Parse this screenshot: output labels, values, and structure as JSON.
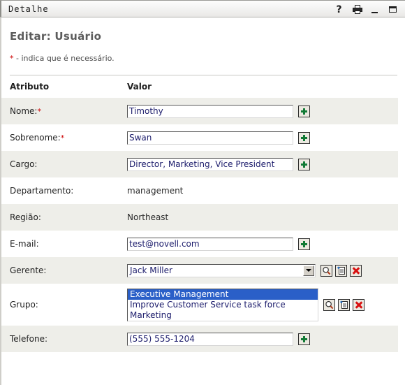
{
  "window": {
    "title": "Detalhe",
    "buttons": [
      {
        "name": "help-icon",
        "glyph": "?"
      },
      {
        "name": "print-icon",
        "glyph": "print"
      },
      {
        "name": "minimize-icon",
        "glyph": "_"
      },
      {
        "name": "maximize-icon",
        "glyph": "square"
      }
    ]
  },
  "page": {
    "title": "Editar: Usuário",
    "required_note_asterisk": "*",
    "required_note": " - indica que é necessário."
  },
  "table": {
    "headers": {
      "attribute": "Atributo",
      "value": "Valor"
    },
    "rows": [
      {
        "label": "Nome:",
        "required": "*",
        "value": "Timothy",
        "control": "text",
        "actions": [
          "plus"
        ]
      },
      {
        "label": "Sobrenome:",
        "required": "*",
        "value": "Swan",
        "control": "text",
        "actions": [
          "plus"
        ]
      },
      {
        "label": "Cargo:",
        "required": "",
        "value": "Director, Marketing, Vice President",
        "control": "text",
        "actions": [
          "plus"
        ]
      },
      {
        "label": "Departamento:",
        "required": "",
        "value": "management",
        "control": "static",
        "actions": []
      },
      {
        "label": "Região:",
        "required": "",
        "value": "Northeast",
        "control": "static",
        "actions": []
      },
      {
        "label": "E-mail:",
        "required": "",
        "value": "test@novell.com",
        "control": "text",
        "actions": [
          "plus"
        ]
      },
      {
        "label": "Gerente:",
        "required": "",
        "value": "Jack Miller",
        "control": "select",
        "actions": [
          "search",
          "new",
          "remove"
        ]
      },
      {
        "label": "Grupo:",
        "required": "",
        "value": "Executive Management",
        "control": "listbox",
        "actions": [
          "search",
          "new",
          "remove"
        ],
        "options": [
          "Executive Management",
          "Improve Customer Service task force",
          "Marketing"
        ],
        "selected_index": 0
      },
      {
        "label": "Telefone:",
        "required": "",
        "value": "(555) 555-1204",
        "control": "text",
        "actions": [
          "plus"
        ]
      }
    ]
  },
  "colors": {
    "row_shade": "#eeeee9",
    "row_plain": "#ffffff",
    "required_asterisk": "#cc0000",
    "plus_green": "#117a35",
    "remove_red": "#d81010",
    "list_selection": "#2a5fc8",
    "field_text": "#1b1b6b"
  }
}
